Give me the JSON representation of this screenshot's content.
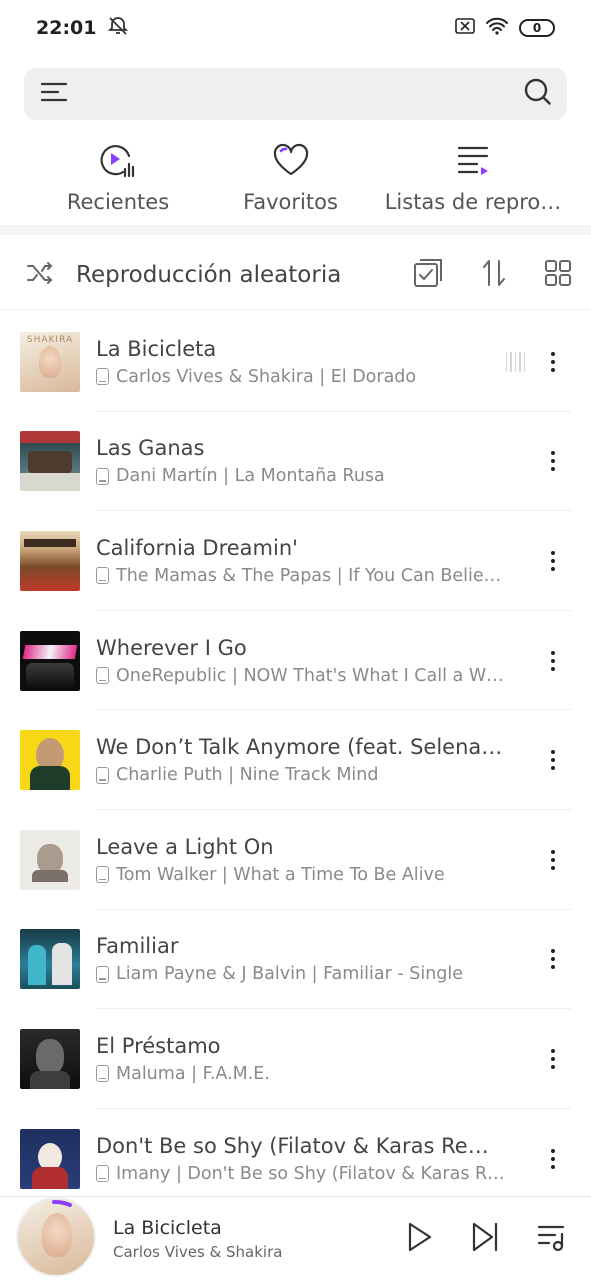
{
  "status": {
    "time": "22:01",
    "battery": "0"
  },
  "tabs": [
    {
      "label": "Recientes",
      "icon": "recent-play-icon"
    },
    {
      "label": "Favoritos",
      "icon": "heart-icon"
    },
    {
      "label": "Listas de repro…",
      "icon": "playlist-icon"
    }
  ],
  "shuffle": {
    "label": "Reproducción aleatoria"
  },
  "songs": [
    {
      "title": "La Bicicleta",
      "subtitle": "Carlos Vives & Shakira | El Dorado"
    },
    {
      "title": "Las Ganas",
      "subtitle": "Dani Martín | La Montaña Rusa"
    },
    {
      "title": "California Dreamin'",
      "subtitle": "The Mamas & The Papas | If You Can Belie…"
    },
    {
      "title": "Wherever I Go",
      "subtitle": "OneRepublic | NOW That's What I Call a W…"
    },
    {
      "title": "We Don’t Talk Anymore (feat. Selena G…",
      "subtitle": "Charlie Puth | Nine Track Mind"
    },
    {
      "title": "Leave a Light On",
      "subtitle": "Tom Walker | What a Time To Be Alive"
    },
    {
      "title": "Familiar",
      "subtitle": "Liam Payne & J Balvin | Familiar - Single"
    },
    {
      "title": "El Préstamo",
      "subtitle": "Maluma | F.A.M.E."
    },
    {
      "title": "Don't Be so Shy (Filatov & Karas Remix)",
      "subtitle": "Imany | Don't Be so Shy (Filatov & Karas R…"
    }
  ],
  "now_playing": {
    "title": "La Bicicleta",
    "artist": "Carlos Vives & Shakira"
  },
  "colors": {
    "accent": "#8a3ffc"
  }
}
